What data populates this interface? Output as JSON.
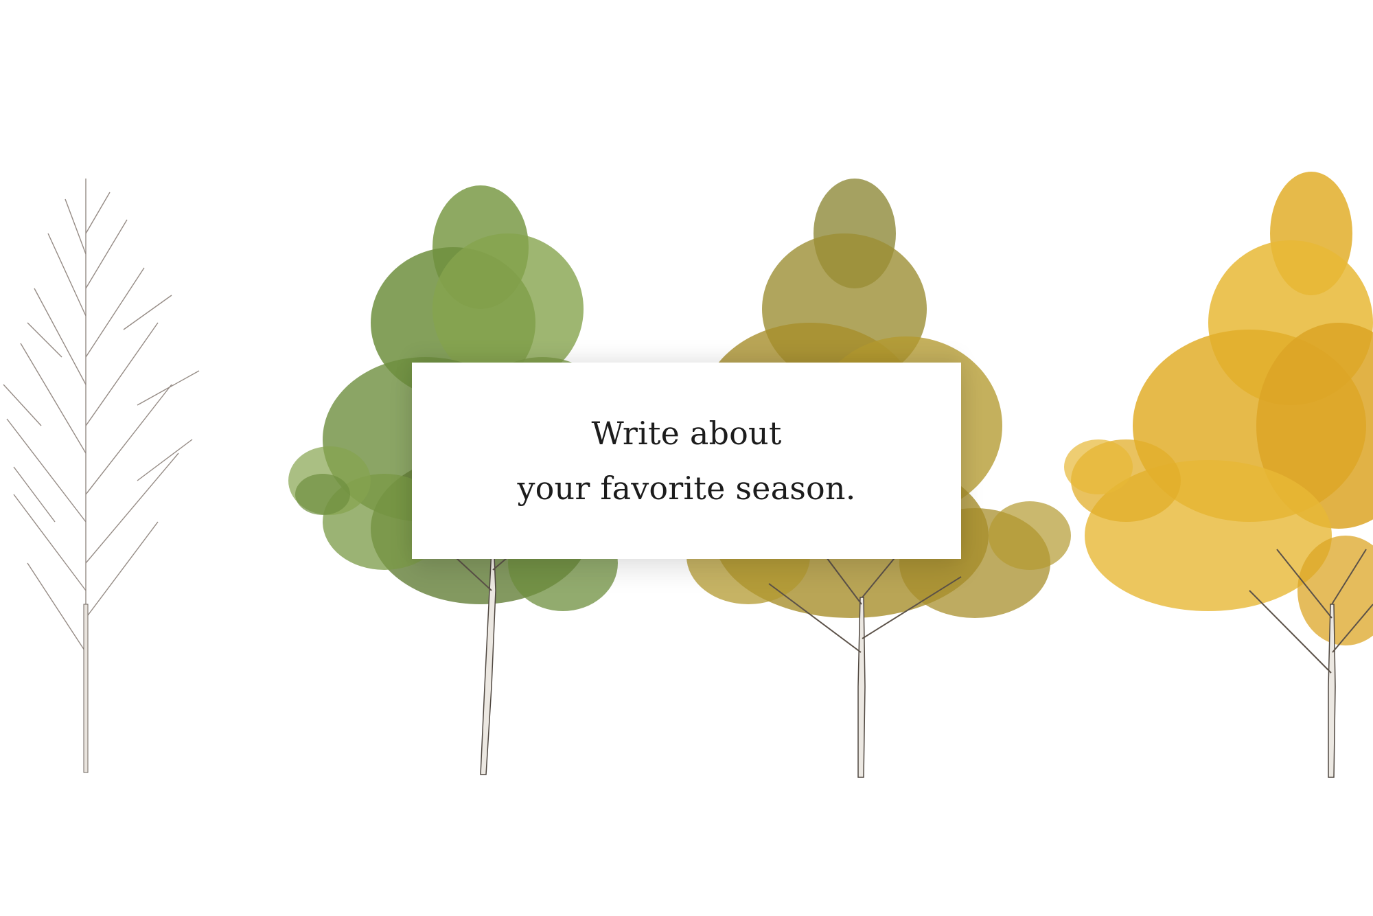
{
  "prompt": {
    "line1": "Write about",
    "line2": "your favorite season."
  },
  "trees": [
    {
      "name": "winter-tree",
      "leaf_color": "#e6dfd8",
      "branch_color": "#8a7f78",
      "bare": true
    },
    {
      "name": "spring-tree",
      "leaf_color": "#6e8f3e",
      "branch_color": "#5b5148",
      "bare": false
    },
    {
      "name": "autumn-tree-early",
      "leaf_color": "#a88f2c",
      "branch_color": "#5b5148",
      "bare": false
    },
    {
      "name": "autumn-tree-late",
      "leaf_color": "#e2ae2a",
      "branch_color": "#5b5148",
      "bare": false
    }
  ],
  "colors": {
    "background": "#ffffff",
    "text": "#1c1c1c"
  }
}
